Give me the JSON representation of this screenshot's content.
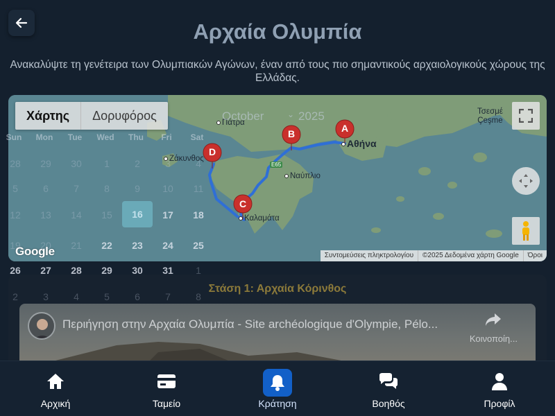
{
  "header": {
    "title": "Αρχαία Ολυμπία",
    "subtitle": "Ανακαλύψτε τη γενέτειρα των Ολυμπιακών Αγώνων, έναν από τους πιο σημαντικούς αρχαιολογικούς χώρους της Ελλάδας."
  },
  "map": {
    "type_tabs": [
      "Χάρτης",
      "Δορυφόρος"
    ],
    "active_tab": "Χάρτης",
    "cities": {
      "patra": "Πάτρα",
      "zakynthos": "Ζάκυνθος",
      "nafplio": "Ναύπλιο",
      "kalamata": "Καλαμάτα",
      "athina": "Αθήνα",
      "cesme": "Τσεσμέ",
      "cesme_latin": "Çeşme"
    },
    "road_badge": "E65",
    "markers": [
      "A",
      "B",
      "C",
      "D"
    ],
    "google_logo": "Google",
    "attribution": {
      "shortcuts": "Συντομεύσεις πληκτρολογίου",
      "data": "©2025 Δεδομένα χάρτη Google",
      "terms": "Όροι"
    },
    "route_color": "#2f6fd6",
    "marker_color": "#c9302c"
  },
  "calendar_overlay": {
    "month": "October",
    "year": "2025",
    "weekdays": [
      "Sun",
      "Mon",
      "Tue",
      "Wed",
      "Thu",
      "Fri",
      "Sat"
    ],
    "rows": [
      [
        "28",
        "29",
        "30",
        "1",
        "2",
        "3",
        "4"
      ],
      [
        "5",
        "6",
        "7",
        "8",
        "9",
        "10",
        "11"
      ],
      [
        "12",
        "13",
        "14",
        "15",
        "16",
        "17",
        "18"
      ],
      [
        "19",
        "20",
        "21",
        "22",
        "23",
        "24",
        "25"
      ],
      [
        "26",
        "27",
        "28",
        "29",
        "30",
        "31",
        "1"
      ],
      [
        "2",
        "3",
        "4",
        "5",
        "6",
        "7",
        "8"
      ]
    ],
    "today": "16"
  },
  "stop": {
    "title": "Στάση 1: Αρχαία Κόρινθος",
    "video_title": "Περιήγηση στην Αρχαία Ολυμπία - Site archéologique d'Olympie, Pélo...",
    "share_label": "Κοινοποίη..."
  },
  "bottom_nav": [
    {
      "label": "Αρχική",
      "icon": "home-icon"
    },
    {
      "label": "Ταμείο",
      "icon": "card-icon"
    },
    {
      "label": "Κράτηση",
      "icon": "bell-icon"
    },
    {
      "label": "Βοηθός",
      "icon": "chat-icon"
    },
    {
      "label": "Προφίλ",
      "icon": "user-icon"
    }
  ],
  "active_nav": "Κράτηση"
}
